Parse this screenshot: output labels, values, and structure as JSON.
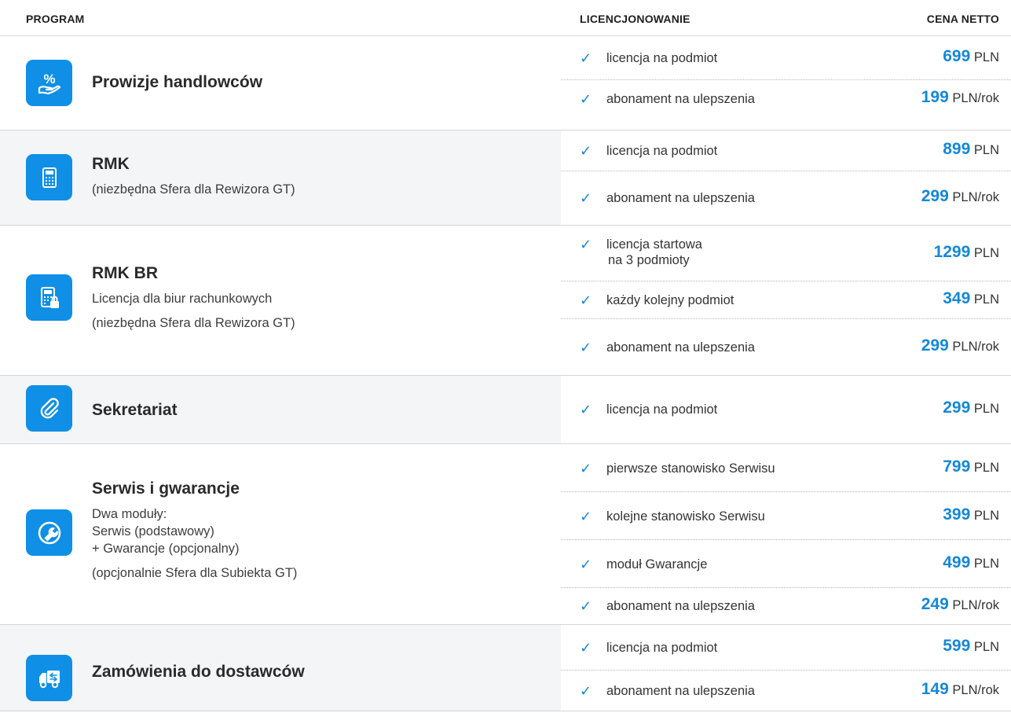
{
  "header": {
    "program": "PROGRAM",
    "licensing": "LICENCJONOWANIE",
    "price": "CENA NETTO"
  },
  "accent_color": "#0f8fe6",
  "rows": [
    {
      "icon": "percent-hand-icon",
      "title": "Prowizje handlowców",
      "desc": [],
      "lines": [
        {
          "text": [
            "licencja na podmiot"
          ],
          "price": "699",
          "unit": "PLN"
        },
        {
          "text": [
            "abonament na ulepszenia"
          ],
          "price": "199",
          "unit": "PLN/rok"
        }
      ]
    },
    {
      "icon": "calculator-icon",
      "title": "RMK",
      "desc": [
        "(niezbędna Sfera dla Rewizora GT)"
      ],
      "lines": [
        {
          "text": [
            "licencja na podmiot"
          ],
          "price": "899",
          "unit": "PLN"
        },
        {
          "text": [
            "abonament na ulepszenia"
          ],
          "price": "299",
          "unit": "PLN/rok"
        }
      ]
    },
    {
      "icon": "calculator-lock-icon",
      "title": "RMK BR",
      "desc": [
        "Licencja dla biur rachunkowych",
        "(niezbędna Sfera dla Rewizora GT)"
      ],
      "lines": [
        {
          "text": [
            "licencja startowa",
            "na 3 podmioty"
          ],
          "price": "1299",
          "unit": "PLN"
        },
        {
          "text": [
            "każdy kolejny podmiot"
          ],
          "price": "349",
          "unit": "PLN"
        },
        {
          "text": [
            "abonament na ulepszenia"
          ],
          "price": "299",
          "unit": "PLN/rok"
        }
      ]
    },
    {
      "icon": "paperclip-icon",
      "title": "Sekretariat",
      "desc": [],
      "lines": [
        {
          "text": [
            "licencja na podmiot"
          ],
          "price": "299",
          "unit": "PLN"
        }
      ]
    },
    {
      "icon": "wrench-icon",
      "title": "Serwis i gwarancje",
      "desc": [
        "Dwa moduły:",
        "Serwis (podstawowy)",
        "+ Gwarancje (opcjonalny)",
        "(opcjonalnie Sfera dla Subiekta GT)"
      ],
      "lines": [
        {
          "text": [
            "pierwsze stanowisko Serwisu"
          ],
          "price": "799",
          "unit": "PLN"
        },
        {
          "text": [
            "kolejne stanowisko Serwisu"
          ],
          "price": "399",
          "unit": "PLN"
        },
        {
          "text": [
            "moduł Gwarancje"
          ],
          "price": "499",
          "unit": "PLN"
        },
        {
          "text": [
            "abonament na ulepszenia"
          ],
          "price": "249",
          "unit": "PLN/rok"
        }
      ]
    },
    {
      "icon": "delivery-truck-icon",
      "title": "Zamówienia do dostawców",
      "desc": [],
      "lines": [
        {
          "text": [
            "licencja na podmiot"
          ],
          "price": "599",
          "unit": "PLN"
        },
        {
          "text": [
            "abonament na ulepszenia"
          ],
          "price": "149",
          "unit": "PLN/rok"
        }
      ]
    }
  ]
}
